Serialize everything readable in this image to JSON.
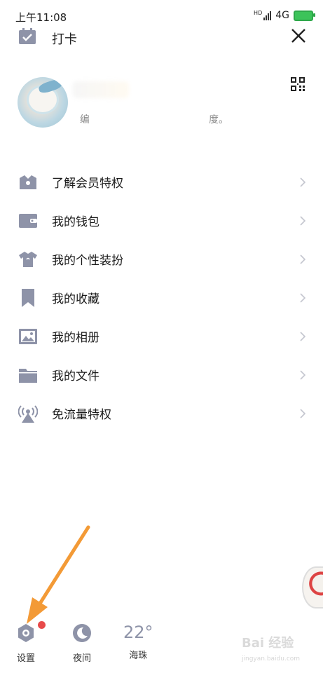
{
  "status_bar": {
    "time": "上午11:08",
    "network": "4G",
    "hd": "HD",
    "battery_color": "#3cc35a"
  },
  "header": {
    "checkin_label": "打卡"
  },
  "profile": {
    "signature_prefix": "编",
    "signature_suffix": "度。"
  },
  "menu": {
    "items": [
      {
        "label": "了解会员特权",
        "icon": "crown-icon"
      },
      {
        "label": "我的钱包",
        "icon": "wallet-icon"
      },
      {
        "label": "我的个性装扮",
        "icon": "shirt-icon"
      },
      {
        "label": "我的收藏",
        "icon": "bookmark-icon"
      },
      {
        "label": "我的相册",
        "icon": "photo-icon"
      },
      {
        "label": "我的文件",
        "icon": "folder-icon"
      },
      {
        "label": "免流量特权",
        "icon": "broadcast-icon"
      }
    ]
  },
  "bottom_bar": {
    "settings_label": "设置",
    "night_label": "夜间",
    "weather_temp": "22°",
    "weather_city": "海珠"
  },
  "colors": {
    "icon_gray": "#8e93a8",
    "arrow": "#f39a36",
    "badge": "#e84a4a"
  },
  "watermark": {
    "text": "Bai 经验",
    "sub": "jingyan.baidu.com"
  }
}
